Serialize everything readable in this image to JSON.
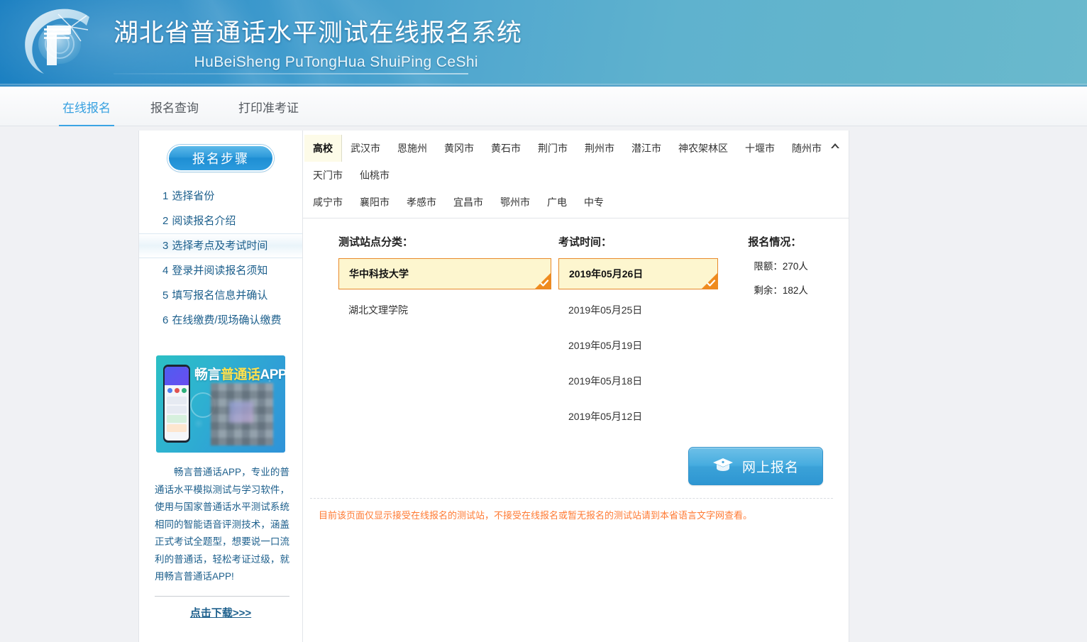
{
  "header": {
    "title_cn": "湖北省普通话水平测试在线报名系统",
    "title_en": "HuBeiSheng  PuTongHua ShuiPing CeShi",
    "logo_icon": "p-swoosh-logo-icon"
  },
  "nav": {
    "items": [
      {
        "label": "在线报名",
        "active": true
      },
      {
        "label": "报名查询",
        "active": false
      },
      {
        "label": "打印准考证",
        "active": false
      }
    ]
  },
  "sidebar": {
    "steps_button": "报名步骤",
    "steps": [
      {
        "num": "1",
        "label": "选择省份"
      },
      {
        "num": "2",
        "label": "阅读报名介绍"
      },
      {
        "num": "3",
        "label": "选择考点及考试时间"
      },
      {
        "num": "4",
        "label": "登录并阅读报名须知"
      },
      {
        "num": "5",
        "label": "填写报名信息并确认"
      },
      {
        "num": "6",
        "label": "在线缴费/现场确认缴费"
      }
    ],
    "promo": {
      "banner_title_1": "畅言",
      "banner_title_2": "普通话",
      "banner_title_3": "APP",
      "qr_icon": "blurred-qr-code-icon",
      "phone_icon": "phone-mockup-icon",
      "text": "畅言普通话APP，专业的普通话水平模拟测试与学习软件，使用与国家普通话水平测试系统相同的智能语音评测技术，涵盖正式考试全题型，想要说一口流利的普通话，轻松考证过级，就用畅言普通话APP!",
      "download_label": "点击下载>>>"
    }
  },
  "content": {
    "tabs": [
      {
        "label": "高校",
        "active": true
      },
      {
        "label": "武汉市",
        "active": false
      },
      {
        "label": "恩施州",
        "active": false
      },
      {
        "label": "黄冈市",
        "active": false
      },
      {
        "label": "黄石市",
        "active": false
      },
      {
        "label": "荆门市",
        "active": false
      },
      {
        "label": "荆州市",
        "active": false
      },
      {
        "label": "潜江市",
        "active": false
      },
      {
        "label": "神农架林区",
        "active": false
      },
      {
        "label": "十堰市",
        "active": false
      },
      {
        "label": "随州市",
        "active": false
      },
      {
        "label": "天门市",
        "active": false
      },
      {
        "label": "仙桃市",
        "active": false
      },
      {
        "label": "咸宁市",
        "active": false
      },
      {
        "label": "襄阳市",
        "active": false
      },
      {
        "label": "孝感市",
        "active": false
      },
      {
        "label": "宜昌市",
        "active": false
      },
      {
        "label": "鄂州市",
        "active": false
      },
      {
        "label": "广电",
        "active": false
      },
      {
        "label": "中专",
        "active": false
      }
    ],
    "collapse_icon": "chevron-up-icon",
    "columns": {
      "site_header": "测试站点分类：",
      "time_header": "考试时间：",
      "quota_header": "报名情况："
    },
    "sites": [
      {
        "label": "华中科技大学",
        "selected": true
      },
      {
        "label": "湖北文理学院",
        "selected": false
      }
    ],
    "times": [
      {
        "label": "2019年05月26日",
        "selected": true
      },
      {
        "label": "2019年05月25日",
        "selected": false
      },
      {
        "label": "2019年05月19日",
        "selected": false
      },
      {
        "label": "2019年05月18日",
        "selected": false
      },
      {
        "label": "2019年05月12日",
        "selected": false
      }
    ],
    "quota": {
      "limit": "限额：270人",
      "remaining": "剩余：182人"
    },
    "signup_button": {
      "label": "网上报名",
      "icon": "graduation-cap-icon"
    },
    "warning": "目前该页面仅显示接受在线报名的测试站，不接受在线报名或暂无报名的测试站请到本省语言文字网查看。"
  },
  "colors": {
    "header_start": "#1a7fc1",
    "header_end": "#6ab9cd",
    "accent_blue": "#3ba4e4",
    "selected_bg": "#fdf6cf",
    "selected_border": "#e8892a",
    "corner_orange": "#ef8b1f",
    "warning_orange": "#ff7a33",
    "step_text": "#1c5f8c"
  }
}
